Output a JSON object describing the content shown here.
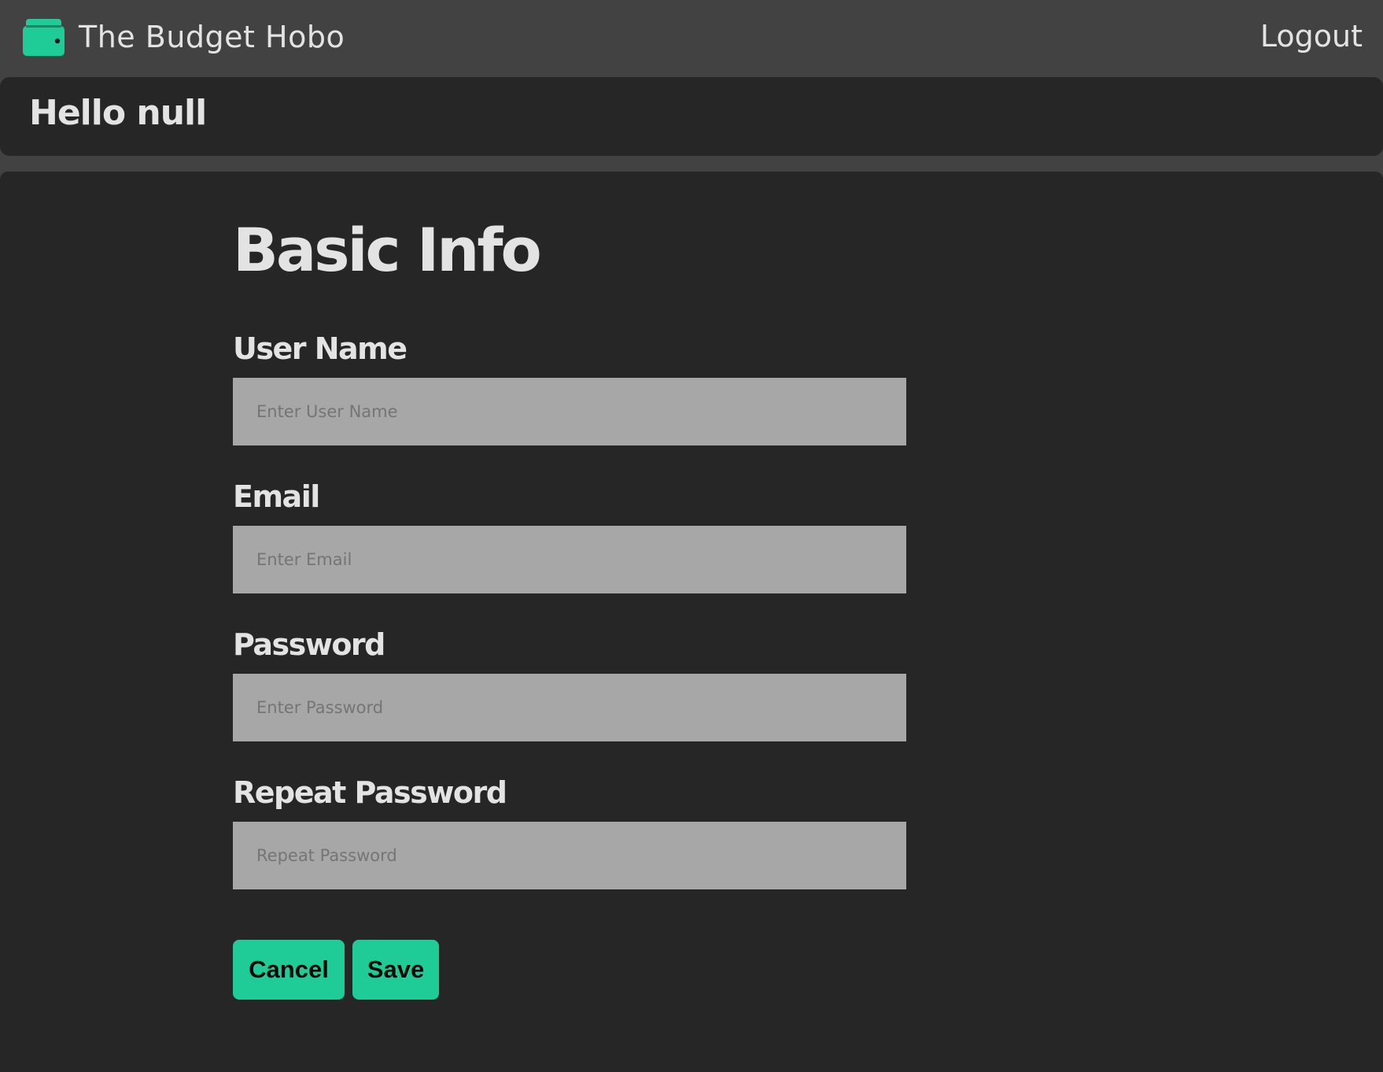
{
  "colors": {
    "accent": "#1fcb96",
    "nav_background": "#424242",
    "panel_background": "#262626",
    "input_background": "#a7a7a7",
    "text": "#e3e3e3"
  },
  "navbar": {
    "brand_icon": "wallet-icon",
    "brand_name": "The Budget Hobo",
    "logout_label": "Logout"
  },
  "greeting": {
    "text": "Hello null"
  },
  "form": {
    "title": "Basic Info",
    "fields": [
      {
        "label": "User Name",
        "placeholder": "Enter User Name",
        "value": ""
      },
      {
        "label": "Email",
        "placeholder": "Enter Email",
        "value": ""
      },
      {
        "label": "Password",
        "placeholder": "Enter Password",
        "value": ""
      },
      {
        "label": "Repeat Password",
        "placeholder": "Repeat Password",
        "value": ""
      }
    ],
    "cancel_label": "Cancel",
    "save_label": "Save"
  }
}
